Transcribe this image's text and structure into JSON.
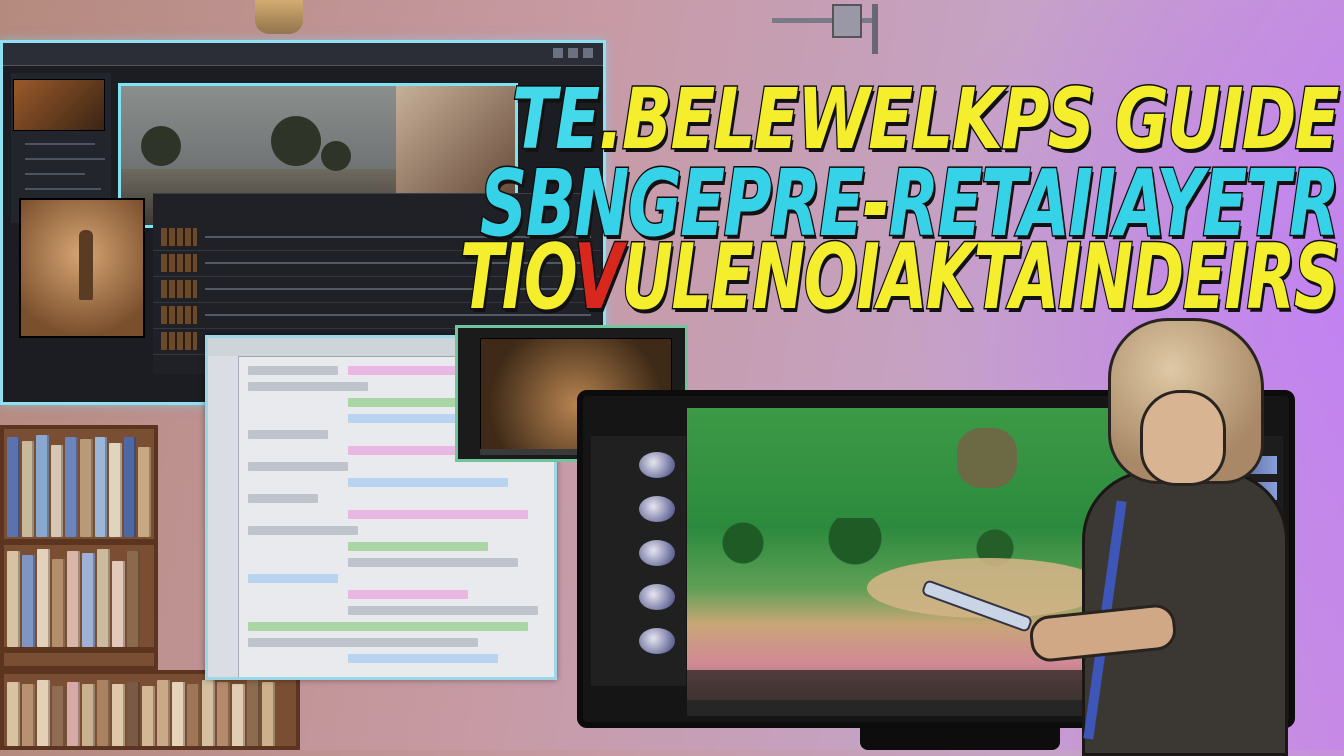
{
  "title": {
    "line1_part_a": "TE",
    "line1_part_b": ".BELEWELKPS GUIDE",
    "line2_part_a": "SBNGEPRE",
    "line2_dash": "-",
    "line2_part_b": "RETAIIAYETR",
    "line3_part_a": "TIO",
    "line3_red": "V",
    "line3_part_b": "ULENOIAKTAINDEIRS"
  },
  "colors": {
    "title_yellow": "#f4ee2c",
    "title_cyan": "#35d2e8",
    "title_red": "#d8281e",
    "window_outline": "#8fe0f0",
    "game_green": "#3c9a46"
  },
  "icons": {
    "windows": [
      "video-editor-window",
      "code-editor-window",
      "preview-window",
      "monitor-game-view"
    ]
  }
}
